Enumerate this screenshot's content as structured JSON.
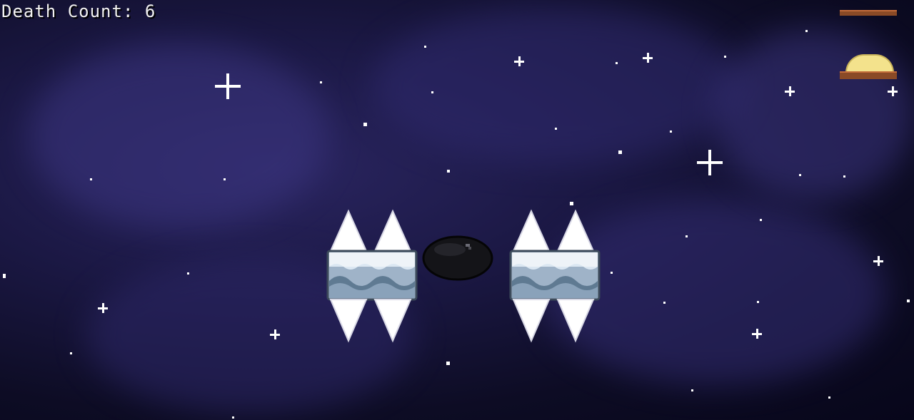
{
  "hud": {
    "death_count": "Death Count: 6"
  },
  "colors": {
    "space_bg": "#141236",
    "spike": "#ffffff",
    "ice_light": "#dbe7f2",
    "ice_mid": "#9fb3c8",
    "ice_dark": "#5f7a92",
    "player": "#141418",
    "goal_bar": "#8a4a26",
    "goal_dome": "#f3e28c"
  },
  "entities": {
    "spike_blocks": [
      {
        "name": "left-spike-block"
      },
      {
        "name": "right-spike-block"
      }
    ],
    "player": {
      "name": "black-slime-player"
    },
    "goal": {
      "name": "golden-dome-goal"
    }
  }
}
